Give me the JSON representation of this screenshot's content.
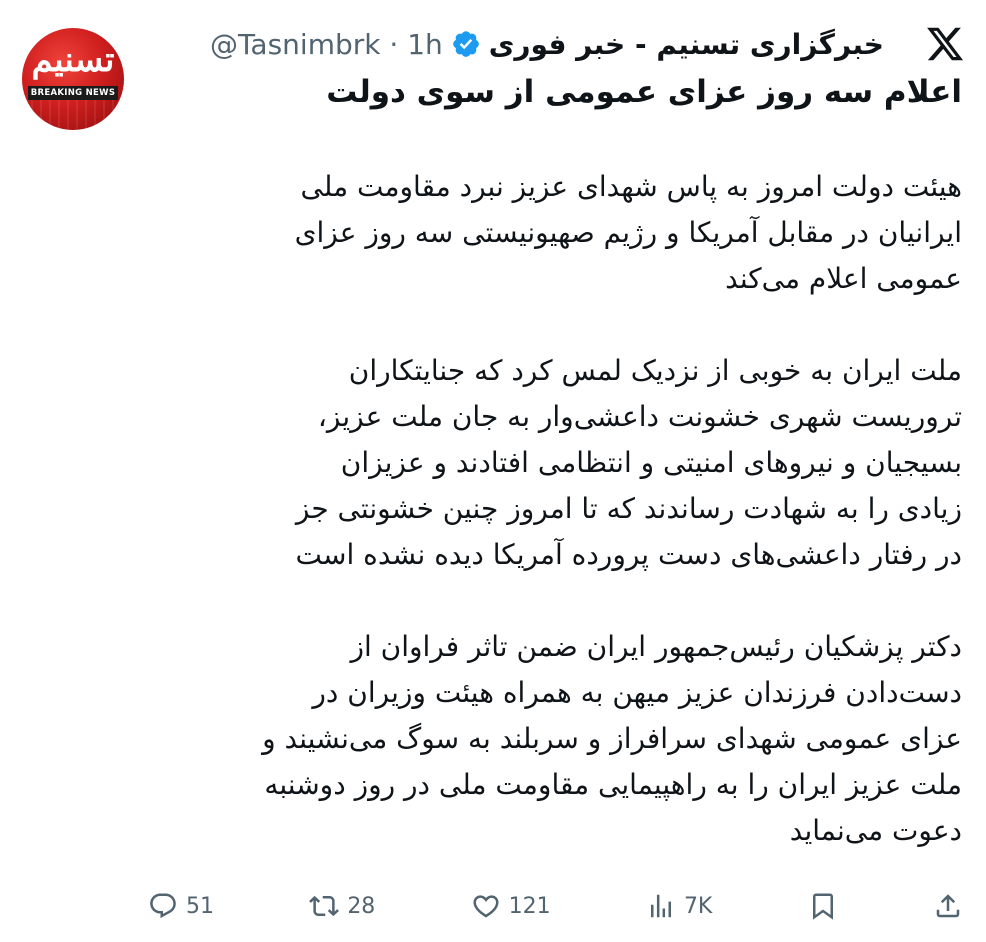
{
  "tweet": {
    "avatar": {
      "logo_text": "تسنیم",
      "breaking_text": "BREAKING NEWS"
    },
    "author": {
      "display_name": "خبرگزاری تسنیم - خبر فوری",
      "handle": "@Tasnimbrk",
      "time": "1h",
      "separator": "·",
      "verified": true
    },
    "headline": "اعلام سه روز عزای عمومی از سوی دولت",
    "paragraphs": [
      "هیئت دولت امروز به پاس شهدای عزیز نبرد مقاومت ملی\nایرانیان در مقابل آمریکا و رژیم صهیونیستی سه روز عزای\nعمومی اعلام می‌کند",
      "ملت ایران به خوبی از نزدیک لمس کرد که جنایتکاران\nتروریست شهری خشونت داعشی‌وار به جان ملت عزیز،\nبسیجیان و نیروهای امنیتی و انتظامی افتادند و عزیزان\nزیادی را به شهادت رساندند که تا امروز چنین خشونتی جز\nدر رفتار داعشی‌های دست پرورده آمریکا دیده نشده است",
      "دکتر پزشکیان رئیس‌جمهور ایران ضمن تاثر فراوان از\nدست‌دادن فرزندان عزیز میهن به همراه هیئت وزیران در\nعزای عمومی شهدای سرافراز و سربلند به سوگ می‌نشیند و\nملت عزیز ایران را به راهپیمایی مقاومت ملی در روز دوشنبه\nدعوت می‌نماید"
    ],
    "actions": {
      "replies": "51",
      "reposts": "28",
      "likes": "121",
      "views": "7K"
    },
    "colors": {
      "text": "#0f1419",
      "secondary": "#536471",
      "verified": "#1d9bf0",
      "avatar_red": "#d01f1f"
    },
    "icons": [
      "x-logo-icon",
      "verified-badge-icon",
      "reply-icon",
      "repost-icon",
      "like-icon",
      "views-icon",
      "bookmark-icon",
      "share-icon"
    ]
  }
}
